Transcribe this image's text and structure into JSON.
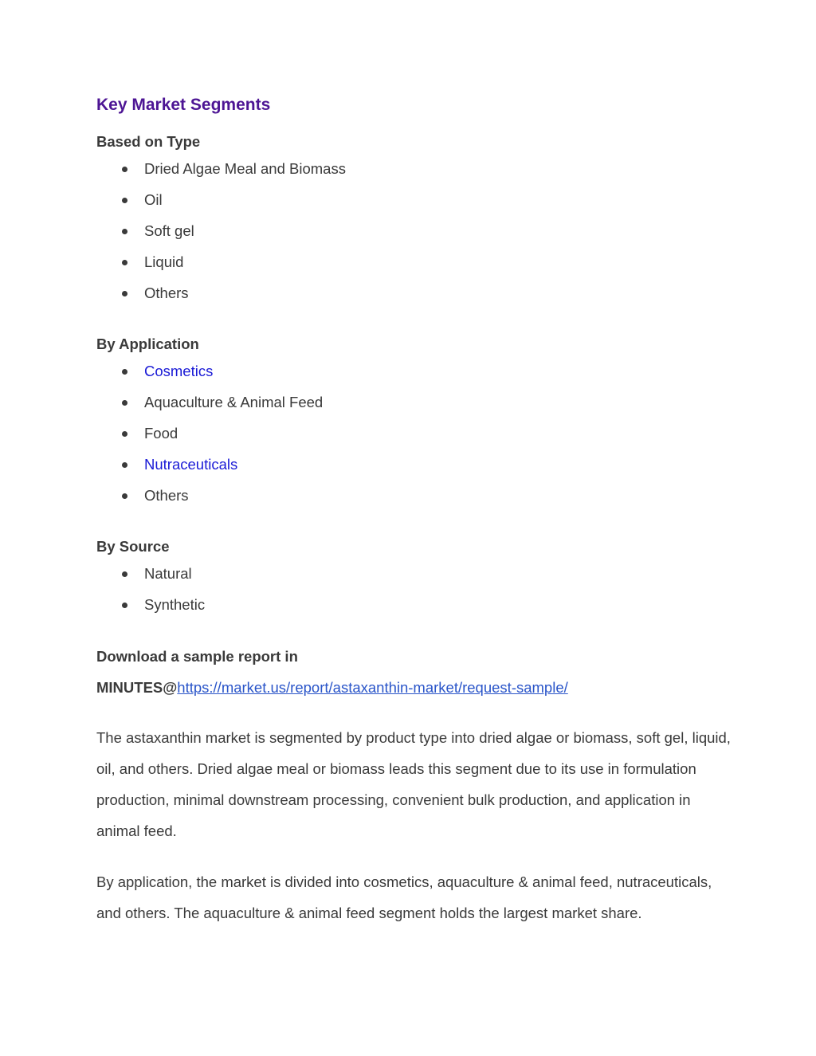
{
  "title": "Key Market Segments",
  "sections": [
    {
      "heading": "Based on Type",
      "items": [
        {
          "label": "Dried Algae Meal and Biomass",
          "link": false
        },
        {
          "label": "Oil",
          "link": false
        },
        {
          "label": "Soft gel",
          "link": false
        },
        {
          "label": "Liquid",
          "link": false
        },
        {
          "label": "Others",
          "link": false
        }
      ]
    },
    {
      "heading": "By Application",
      "items": [
        {
          "label": "Cosmetics",
          "link": true
        },
        {
          "label": "Aquaculture & Animal Feed",
          "link": false
        },
        {
          "label": "Food",
          "link": false
        },
        {
          "label": "Nutraceuticals",
          "link": true
        },
        {
          "label": "Others",
          "link": false
        }
      ]
    },
    {
      "heading": "By Source",
      "items": [
        {
          "label": "Natural",
          "link": false
        },
        {
          "label": "Synthetic",
          "link": false
        }
      ]
    }
  ],
  "download": {
    "line1": "Download a sample report in",
    "prefix": "MINUTES@",
    "url": "https://market.us/report/astaxanthin-market/request-sample/"
  },
  "paragraphs": [
    "The astaxanthin market is segmented by product type into dried algae or biomass, soft gel, liquid, oil, and others. Dried algae meal or biomass leads this segment due to its use in formulation production, minimal downstream processing, convenient bulk production, and application in animal feed.",
    "By application, the market is divided into cosmetics, aquaculture & animal feed, nutraceuticals, and others. The aquaculture & animal feed segment holds the largest market share."
  ],
  "colors": {
    "title": "#4d1594",
    "body_text": "#3a3a3a",
    "inline_link": "#1a1ad6",
    "url_link": "#2a55c9"
  }
}
